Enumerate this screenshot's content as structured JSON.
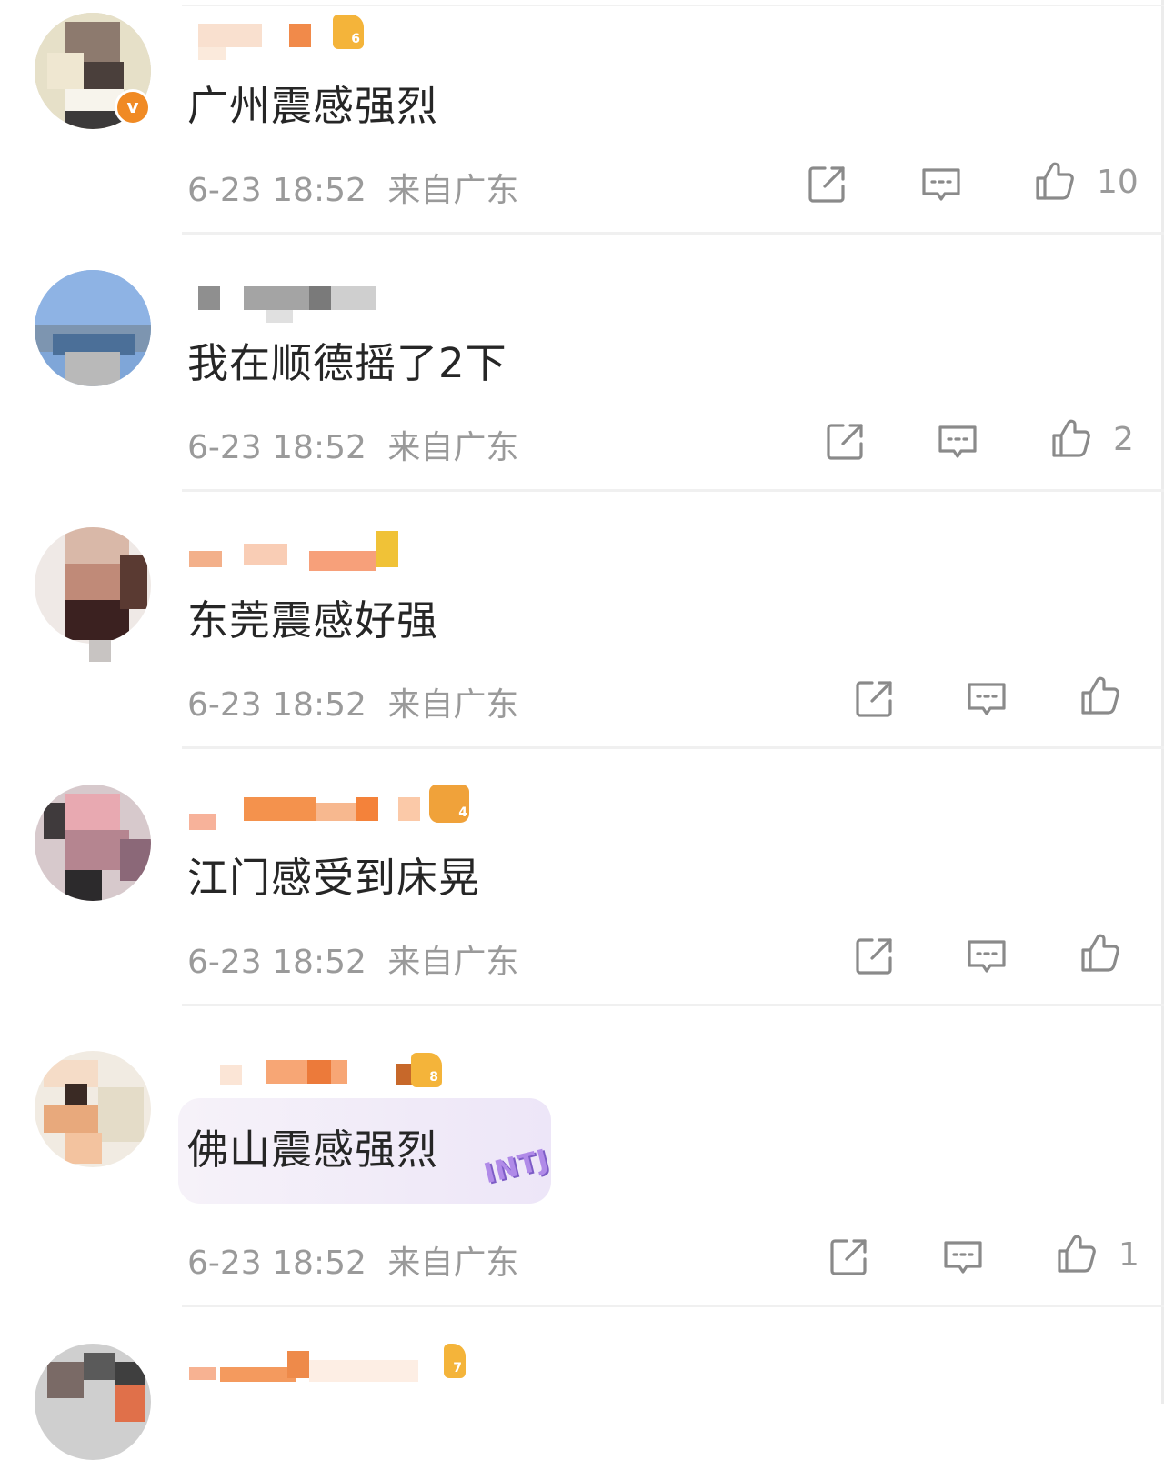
{
  "comments": [
    {
      "text": "广州震感强烈",
      "time": "6-23 18:52",
      "location": "来自广东",
      "likes": "10",
      "verified_badge": "v",
      "level_badge": "6"
    },
    {
      "text": "我在顺德摇了2下",
      "time": "6-23 18:52",
      "location": "来自广东",
      "likes": "2"
    },
    {
      "text": "东莞震感好强",
      "time": "6-23 18:52",
      "location": "来自广东",
      "likes": ""
    },
    {
      "text": "江门感受到床晃",
      "time": "6-23 18:52",
      "location": "来自广东",
      "likes": "",
      "level_badge": "4"
    },
    {
      "text": "佛山震感强烈",
      "time": "6-23 18:52",
      "location": "来自广东",
      "likes": "1",
      "level_badge": "8",
      "bubble_sticker": "INTJ"
    },
    {
      "level_badge": "7"
    }
  ],
  "icons": {
    "share": "share-icon",
    "comment": "comment-icon",
    "like": "like-icon"
  },
  "colors": {
    "text": "#262626",
    "meta": "#9a9a9a",
    "icon": "#8a8a8a",
    "verified": "#f08a24",
    "badge": "#f4b43a"
  }
}
